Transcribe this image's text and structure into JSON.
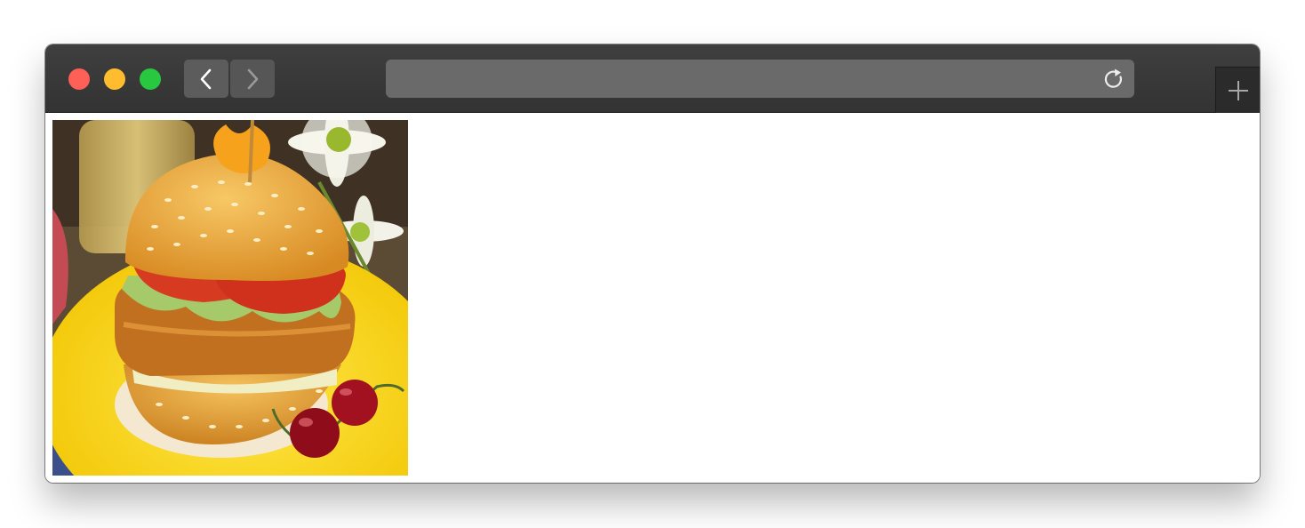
{
  "browser": {
    "address_text": "",
    "buttons": {
      "back": "chevron-left-icon",
      "forward": "chevron-right-icon",
      "reload": "reload-icon",
      "new_tab": "plus-icon"
    },
    "traffic_lights": {
      "close": "#fe5f57",
      "minimize": "#febc2e",
      "zoom": "#28c840"
    }
  },
  "page": {
    "image": {
      "subject": "burger-photo"
    }
  }
}
